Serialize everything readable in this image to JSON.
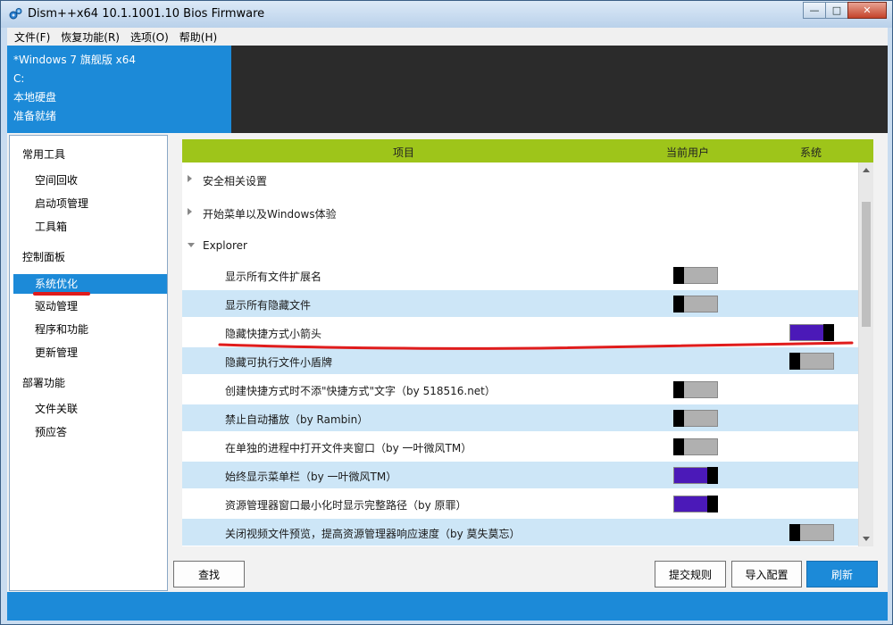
{
  "window": {
    "title": "Dism++x64 10.1.1001.10 Bios Firmware",
    "controls": {
      "minimize": "—",
      "maximize": "□",
      "close": "✕"
    }
  },
  "menu": [
    "文件(F)",
    "恢复功能(R)",
    "选项(O)",
    "帮助(H)"
  ],
  "system_info": {
    "os": "*Windows 7 旗舰版 x64",
    "drive": "C:",
    "disk": "本地硬盘",
    "status": "准备就绪"
  },
  "sidebar": {
    "groups": [
      {
        "title": "常用工具",
        "items": [
          "空间回收",
          "启动项管理",
          "工具箱"
        ]
      },
      {
        "title": "控制面板",
        "items": [
          "系统优化",
          "驱动管理",
          "程序和功能",
          "更新管理"
        ]
      },
      {
        "title": "部署功能",
        "items": [
          "文件关联",
          "预应答"
        ]
      }
    ],
    "selected": "系统优化"
  },
  "table": {
    "columns": [
      "项目",
      "当前用户",
      "系统"
    ],
    "categories": [
      {
        "label": "安全相关设置",
        "expanded": false
      },
      {
        "label": "开始菜单以及Windows体验",
        "expanded": false
      },
      {
        "label": "Explorer",
        "expanded": true
      }
    ],
    "items": [
      {
        "label": "显示所有文件扩展名",
        "user": "off",
        "system": null
      },
      {
        "label": "显示所有隐藏文件",
        "user": "off",
        "system": null
      },
      {
        "label": "隐藏快捷方式小箭头",
        "user": null,
        "system": "on"
      },
      {
        "label": "隐藏可执行文件小盾牌",
        "user": null,
        "system": "off"
      },
      {
        "label": "创建快捷方式时不添\"快捷方式\"文字（by 518516.net）",
        "user": "off",
        "system": null
      },
      {
        "label": "禁止自动播放（by Rambin）",
        "user": "off",
        "system": null
      },
      {
        "label": "在单独的进程中打开文件夹窗口（by 一叶微风TM）",
        "user": "off",
        "system": null
      },
      {
        "label": "始终显示菜单栏（by 一叶微风TM）",
        "user": "on",
        "system": null
      },
      {
        "label": "资源管理器窗口最小化时显示完整路径（by 原罪）",
        "user": "on",
        "system": null
      },
      {
        "label": "关闭视频文件预览，提高资源管理器响应速度（by 莫失莫忘）",
        "user": null,
        "system": "off"
      }
    ]
  },
  "buttons": {
    "find": "查找",
    "submit_rules": "提交规则",
    "import_config": "导入配置",
    "refresh": "刷新"
  },
  "colors": {
    "accent": "#1c8ad8",
    "header_green": "#9ec51a",
    "toggle_on": "#4b19b8",
    "annotation_red": "#e01c1c"
  }
}
